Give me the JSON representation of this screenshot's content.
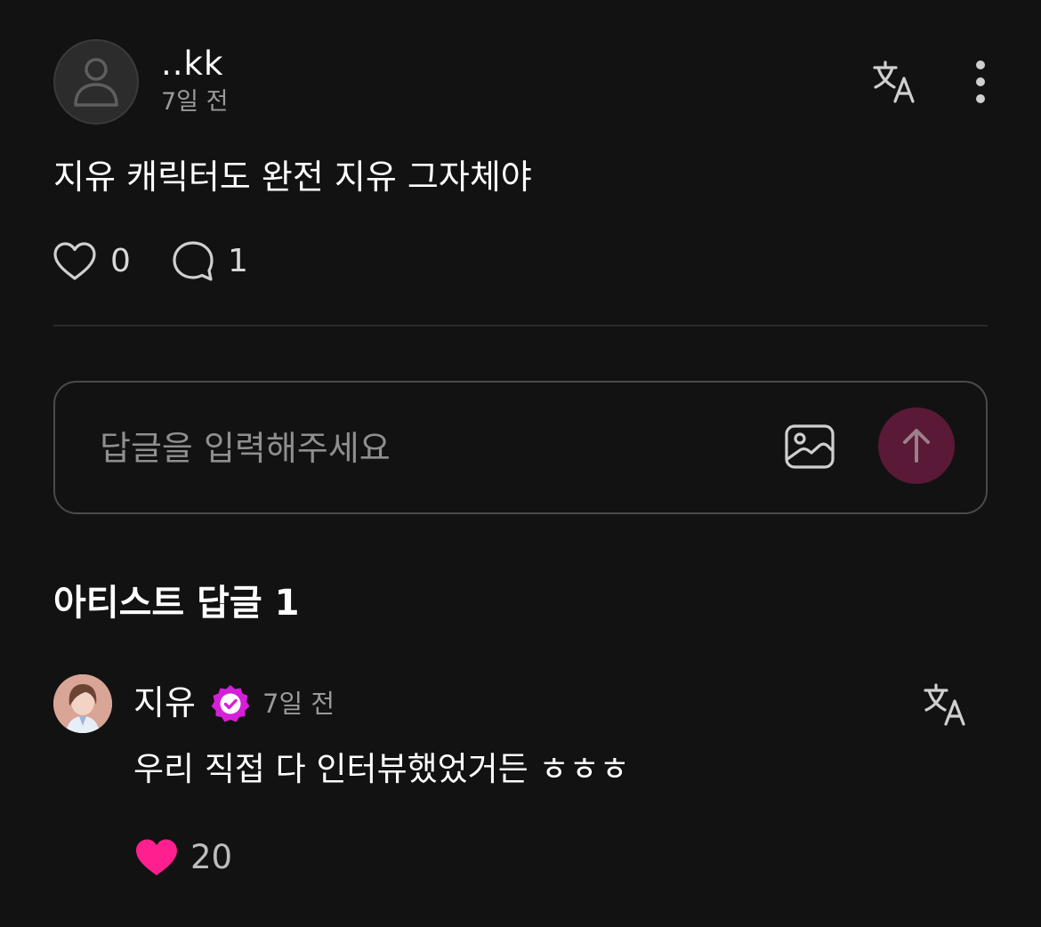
{
  "post": {
    "author": "..kk",
    "time": "7일 전",
    "body": "지유 캐릭터도 완전 지유 그자체야",
    "like_count": "0",
    "comment_count": "1",
    "icons": {
      "avatar": "default-user-icon",
      "translate": "translate-icon",
      "more": "more-vertical-icon",
      "like": "heart-outline-icon",
      "comment": "comment-bubble-icon"
    }
  },
  "reply_input": {
    "placeholder": "답글을 입력해주세요",
    "value": "",
    "icons": {
      "image": "image-icon",
      "send": "arrow-up-icon"
    },
    "send_color": "#5a1936"
  },
  "artist_replies": {
    "title": "아티스트 답글 1",
    "items": [
      {
        "name": "지유",
        "verified": true,
        "badge_color": "#d61fd9",
        "time": "7일 전",
        "text": "우리 직접 다 인터뷰했었거든 ㅎㅎㅎ",
        "like_count": "20",
        "like_color": "#ff1f8e",
        "icons": {
          "avatar": "artist-avatar",
          "verified": "verified-badge-icon",
          "translate": "translate-icon",
          "like": "heart-filled-icon"
        }
      }
    ]
  },
  "colors": {
    "background": "#121212",
    "text_primary": "#ffffff",
    "text_secondary": "#9a9a9a",
    "divider": "#2b2b2b"
  }
}
